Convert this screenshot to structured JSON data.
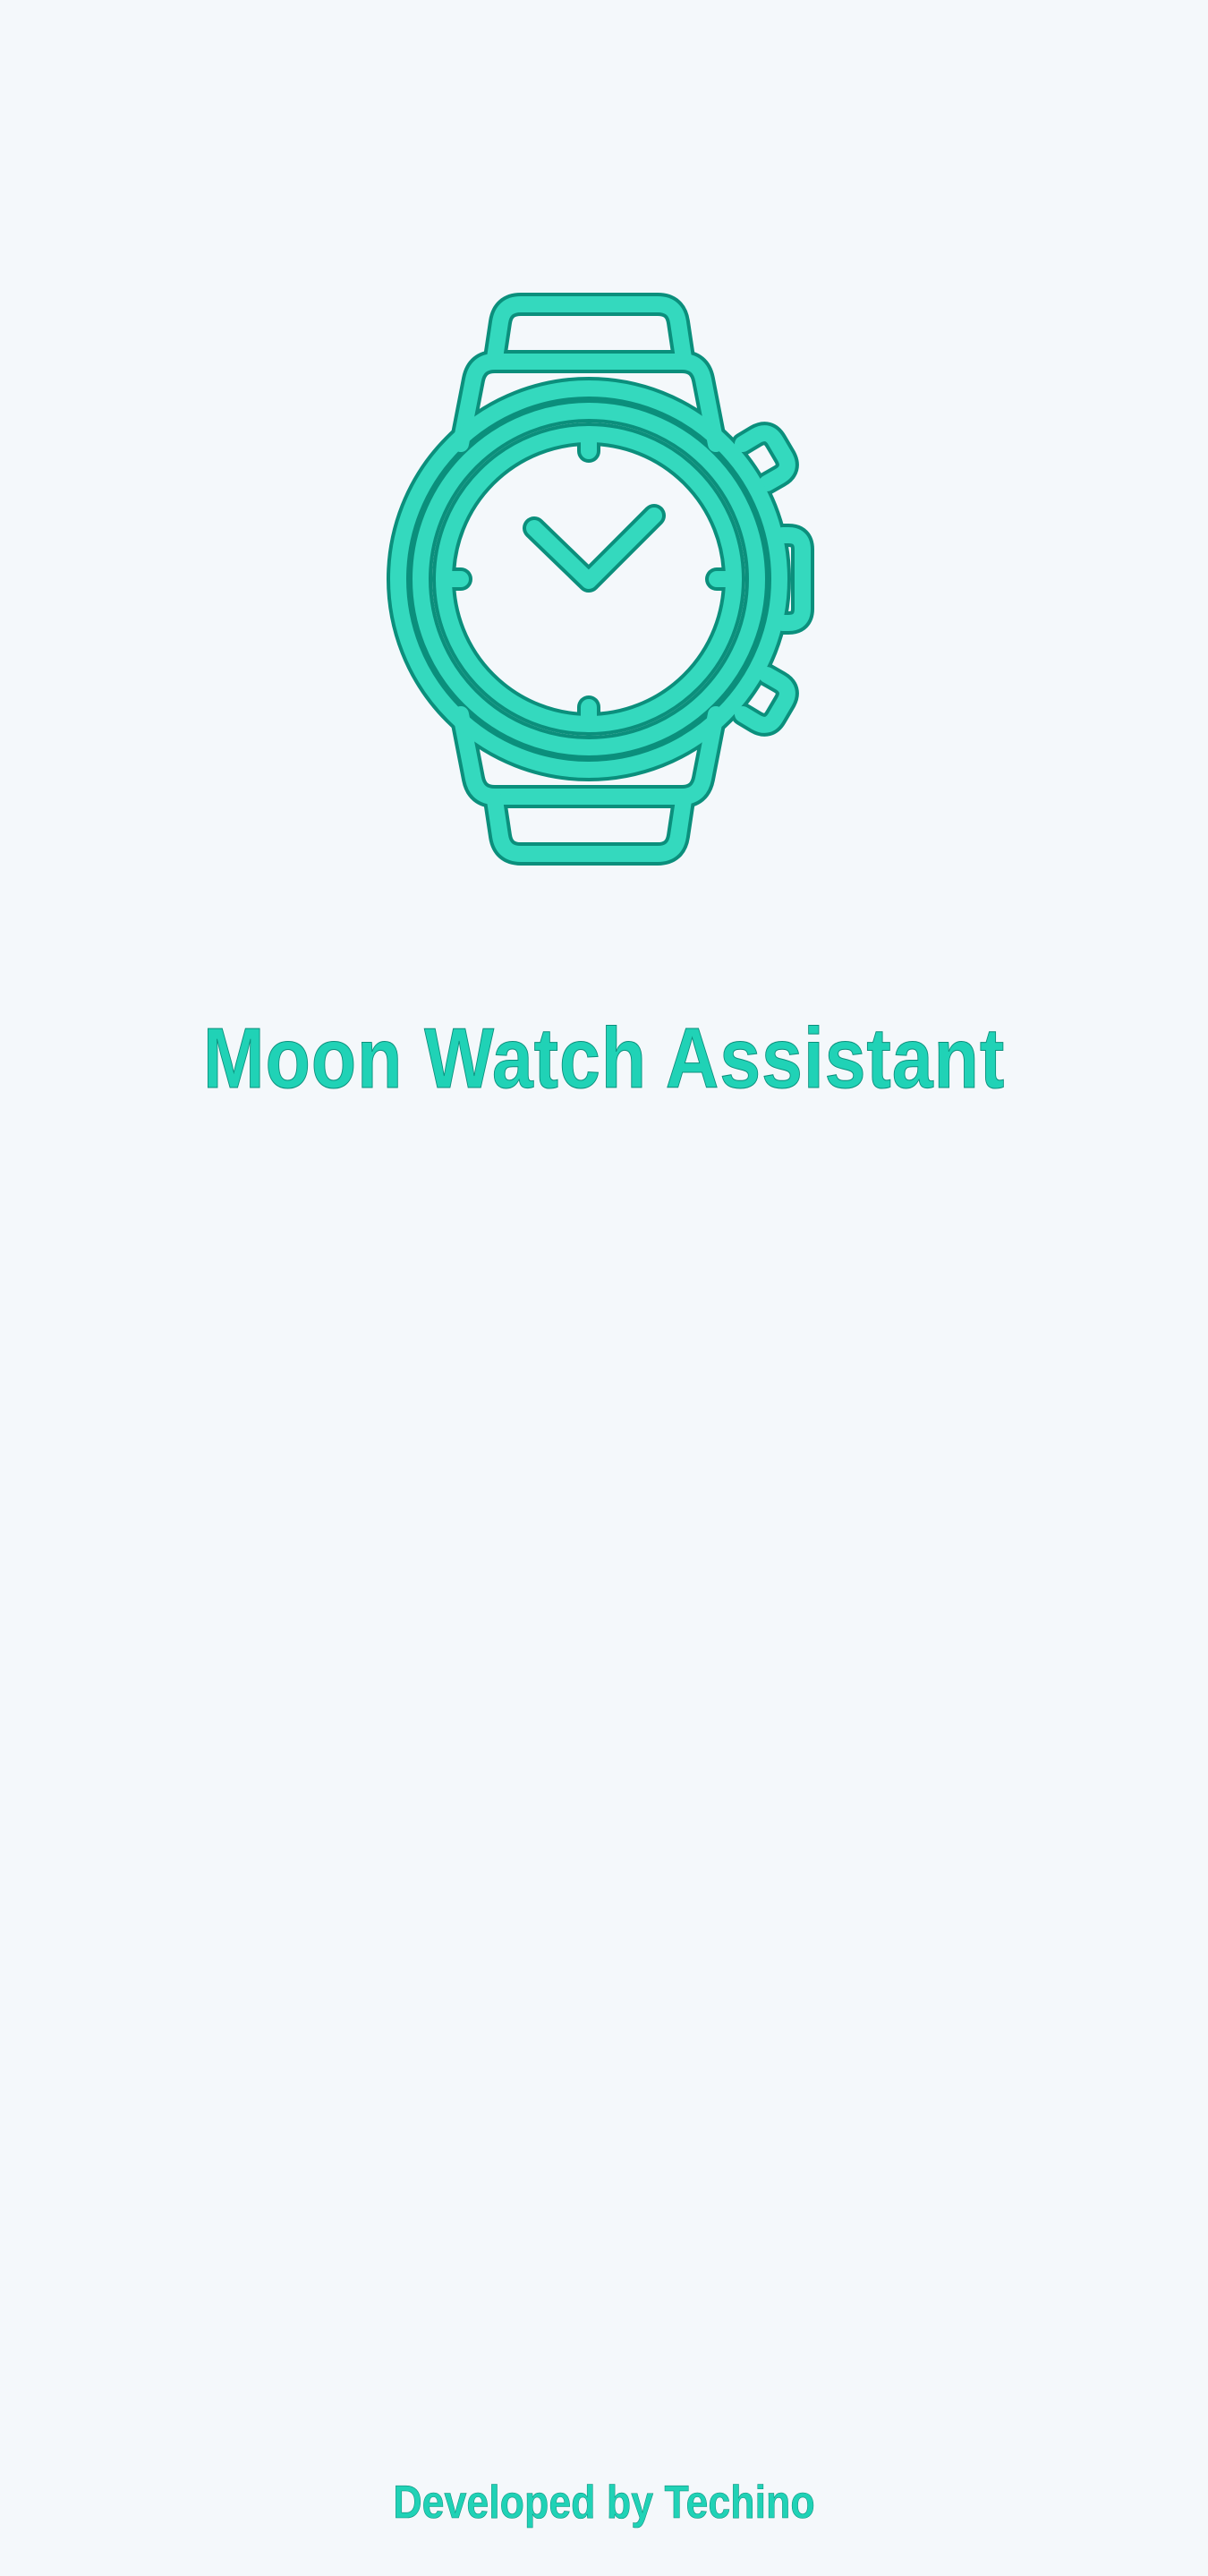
{
  "app": {
    "title": "Moon Watch Assistant",
    "credit": "Developed by Techino"
  },
  "logo": {
    "icon": "wristwatch-icon",
    "color": "#34d9be",
    "stroke": "#0b8f7c"
  },
  "theme": {
    "background": "#f4f8fb",
    "accent": "#20d2b6"
  }
}
